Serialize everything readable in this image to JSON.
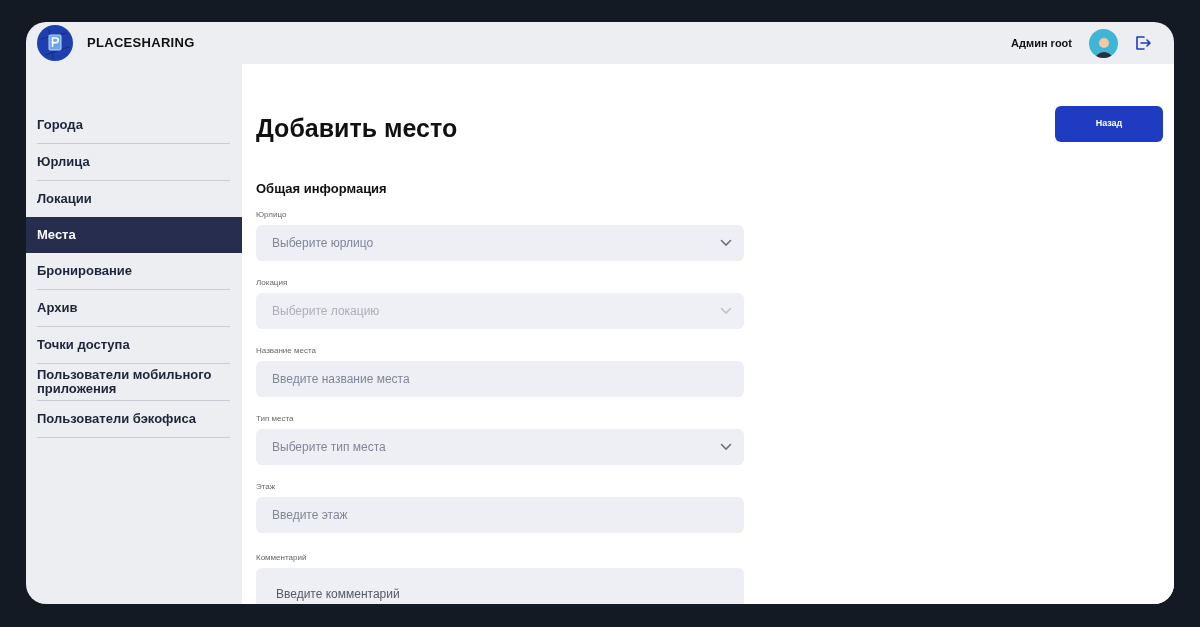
{
  "header": {
    "brand": "PLACESHARING",
    "user_name": "Админ root"
  },
  "sidebar": {
    "items": [
      {
        "label": "Города",
        "selected": false
      },
      {
        "label": "Юрлица",
        "selected": false
      },
      {
        "label": "Локации",
        "selected": false
      },
      {
        "label": "Места",
        "selected": true
      },
      {
        "label": "Бронирование",
        "selected": false
      },
      {
        "label": "Архив",
        "selected": false
      },
      {
        "label": "Точки доступа",
        "selected": false
      },
      {
        "label": "Пользователи мобильного приложения",
        "selected": false
      },
      {
        "label": "Пользователи бэкофиса",
        "selected": false
      }
    ]
  },
  "page": {
    "title": "Добавить место",
    "back_button": "Назад",
    "section_title": "Общая информация"
  },
  "fields": [
    {
      "kind": "select",
      "label": "Юрлицо",
      "placeholder": "Выберите юрлицо",
      "disabled": false
    },
    {
      "kind": "select",
      "label": "Локация",
      "placeholder": "Выберите локацию",
      "disabled": true
    },
    {
      "kind": "input",
      "label": "Название места",
      "placeholder": "Введите название места",
      "disabled": false
    },
    {
      "kind": "select",
      "label": "Тип места",
      "placeholder": "Выберите тип места",
      "disabled": false
    },
    {
      "kind": "input",
      "label": "Этаж",
      "placeholder": "Введите этаж",
      "disabled": false
    },
    {
      "kind": "textarea",
      "label": "Комментарий",
      "placeholder": "Введите комментарий",
      "disabled": false
    }
  ]
}
